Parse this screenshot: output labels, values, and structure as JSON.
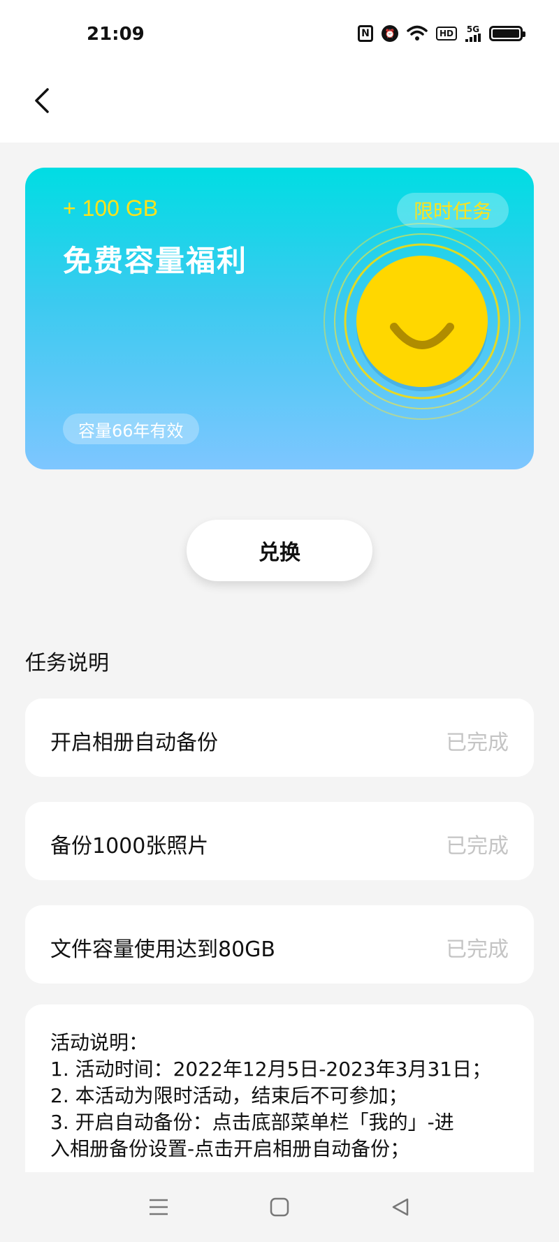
{
  "status_bar": {
    "time": "21:09",
    "icons": [
      "nfc-icon",
      "alarm-icon",
      "wifi-icon",
      "hd-icon",
      "5g-signal-icon",
      "battery-icon"
    ],
    "hd_label": "HD",
    "network_label": "5G"
  },
  "header": {
    "back_icon": "chevron-left-icon"
  },
  "banner": {
    "capacity": "+ 100 GB",
    "title": "免费容量福利",
    "badge": "限时任务",
    "validity": "容量66年有效",
    "colors": {
      "gradient_top": "#00dde3",
      "gradient_bottom": "#7ec6ff",
      "accent_yellow": "#ffe21a",
      "smiley": "#ffd700"
    }
  },
  "exchange_button": {
    "label": "兑换"
  },
  "tasks_section": {
    "title": "任务说明",
    "items": [
      {
        "name": "开启相册自动备份",
        "status": "已完成"
      },
      {
        "name": "备份1000张照片",
        "status": "已完成"
      },
      {
        "name": "文件容量使用达到80GB",
        "status": "已完成"
      }
    ]
  },
  "activity_description": {
    "lines": [
      "活动说明：",
      "1. 活动时间：2022年12月5日-2023年3月31日；",
      "2. 本活动为限时活动，结束后不可参加；",
      "3. 开启自动备份：点击底部菜单栏「我的」-进",
      "入相册备份设置-点击开启相册自动备份；"
    ]
  },
  "nav_bar": {
    "icons": [
      "menu-icon",
      "home-icon",
      "back-triangle-icon"
    ]
  }
}
